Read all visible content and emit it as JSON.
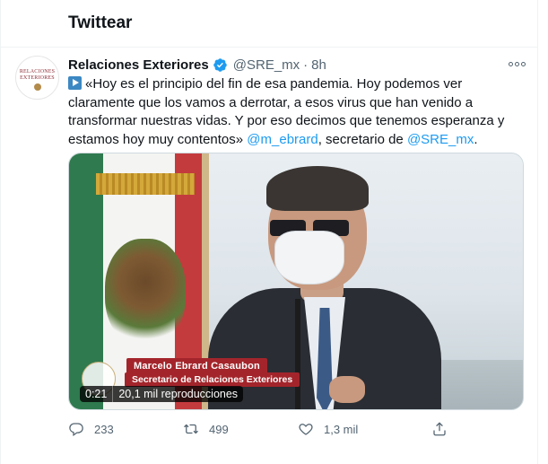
{
  "header": {
    "title": "Twittear"
  },
  "tweet": {
    "avatar": {
      "line1": "RELACIONES",
      "line2": "EXTERIORES"
    },
    "display_name": "Relaciones Exteriores",
    "handle": "@SRE_mx",
    "separator": "·",
    "time": "8h",
    "text": {
      "part1": "«Hoy es el principio del fin de esa pandemia. Hoy podemos ver claramente que los vamos a derrotar, a esos virus que han venido a transformar nuestras vidas. Y por eso decimos que tenemos esperanza y estamos hoy muy contentos» ",
      "mention": "@m_ebrard",
      "part2": ", secretario de ",
      "link": "@SRE_mx",
      "part3": "."
    },
    "media": {
      "lower_third_name": "Marcelo Ebrard Casaubon",
      "lower_third_role": "Secretario de Relaciones Exteriores",
      "duration": "0:21",
      "views": "20,1 mil reproducciones"
    },
    "actions": {
      "reply_count": "233",
      "retweet_count": "499",
      "like_count": "1,3 mil"
    }
  },
  "colors": {
    "accent": "#1d9bf0",
    "muted": "#536471",
    "brand": "#a3252b"
  }
}
